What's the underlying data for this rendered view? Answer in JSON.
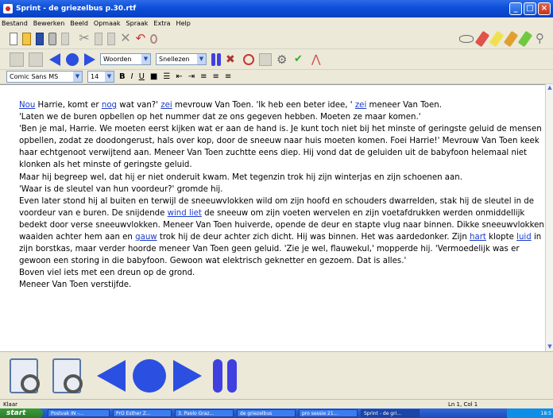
{
  "window": {
    "title": "Sprint - de griezelbus p.30.rtf"
  },
  "menu": [
    "Bestand",
    "Bewerken",
    "Beeld",
    "Opmaak",
    "Spraak",
    "Extra",
    "Help"
  ],
  "toolbar2": {
    "read_mode": "Woorden",
    "speed": "Snellezen"
  },
  "format": {
    "font": "Comic Sans MS",
    "size": "14",
    "bold": "B",
    "italic": "I",
    "underline": "U"
  },
  "document": {
    "paragraphs": [
      [
        {
          "t": "Nou",
          "k": 1
        },
        {
          "t": " Harrie, komt er "
        },
        {
          "t": "nog",
          "k": 1
        },
        {
          "t": " wat van?' "
        },
        {
          "t": "zei",
          "k": 1
        },
        {
          "t": " mevrouw Van Toen. 'Ik heb een beter idee, ' "
        },
        {
          "t": "zei",
          "k": 1
        },
        {
          "t": " meneer Van Toen."
        }
      ],
      [
        {
          "t": "'Laten we de buren opbellen op het nummer dat ze ons gegeven hebben. Moeten ze maar komen.'"
        }
      ],
      [
        {
          "t": "'Ben je mal, Harrie. We moeten eerst kijken wat er aan de hand is. Je kunt toch niet bij het minste of geringste geluid de mensen opbellen, zodat ze doodongerust, hals over kop, door de sneeuw naar huis moeten komen. Foei Harrie!' Mevrouw Van Toen keek haar echtgenoot verwijtend aan. Meneer Van Toen zuchtte eens diep. Hij vond dat de geluiden uit de babyfoon helemaal niet klonken als het minste of geringste geluid."
        }
      ],
      [
        {
          "t": "Maar hij begreep wel, dat hij er niet onderuit kwam. Met tegenzin trok hij zijn winterjas en zijn schoenen aan."
        }
      ],
      [
        {
          "t": "'Waar is de sleutel van hun voordeur?' gromde hij."
        }
      ],
      [
        {
          "t": "Even later stond hij al buiten en terwijl de sneeuwvlokken wild om zijn hoofd en schouders dwarrelden, stak hij de sleutel in de voordeur van e buren. De snijdende "
        },
        {
          "t": "wind liet",
          "k": 1
        },
        {
          "t": " de sneeuw om zijn voeten wervelen en zijn voetafdrukken werden onmiddellijk bedekt door verse sneeuwvlokken. Meneer Van Toen huiverde, opende de deur en stapte vlug naar binnen. Dikke sneeuwvlokken waaiden achter hem aan en "
        },
        {
          "t": "gauw",
          "k": 1
        },
        {
          "t": " trok hij de deur achter zich dicht. Hij was binnen. Het was aardedonker. Zijn "
        },
        {
          "t": "hart",
          "k": 1
        },
        {
          "t": " klopte "
        },
        {
          "t": "luid",
          "k": 1
        },
        {
          "t": " in zijn borstkas, maar verder hoorde meneer Van Toen geen geluid. 'Zie je wel, flauwekul,' mopperde hij. 'Vermoedelijk was er gewoon een storing in die babyfoon. Gewoon wat elektrisch geknetter en gezoem. Dat is alles.'"
        }
      ],
      [
        {
          "t": "Boven viel iets met een dreun op de grond."
        }
      ],
      [
        {
          "t": "Meneer Van Toen verstijfde."
        }
      ]
    ]
  },
  "status": {
    "left": "Klaar",
    "position": "Ln 1, Col 1"
  },
  "taskbar": {
    "start": "start",
    "tasks": [
      "Postvak IN -...",
      "PrO Esther Z...",
      "3. Paolo Graz...",
      "de griezelbus",
      "pro sessie 21...",
      "Sprint - de gri..."
    ],
    "clock": "18:5"
  },
  "colors": {
    "title": "#0c4fd8",
    "keyword": "#1a3ccc",
    "nav": "#2b4fe0",
    "pause": "#4040e0"
  }
}
